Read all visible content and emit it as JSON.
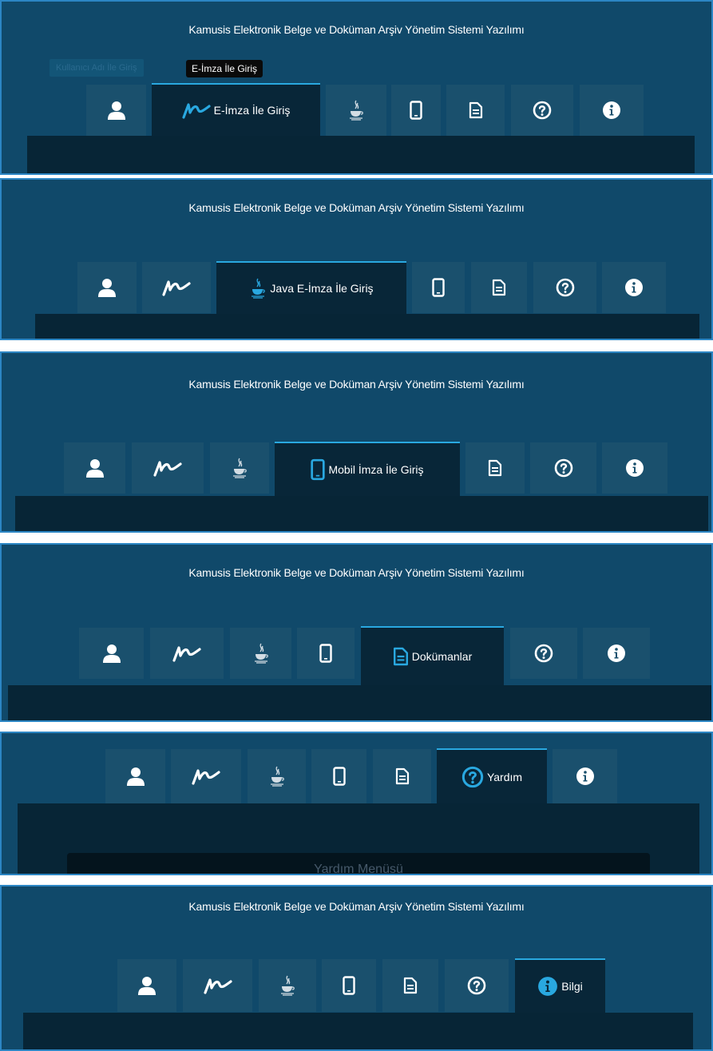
{
  "app_title": "Kamusis Elektronik Belge ve Doküman Arşiv Yönetim Sistemi Yazılımı",
  "tabs": {
    "user": {
      "icon": "user-icon",
      "label": "Kullanıcı Adı İle Giriş"
    },
    "eimza": {
      "icon": "signature-icon",
      "label": "E-İmza İle Giriş"
    },
    "java": {
      "icon": "java-icon",
      "label": "Java E-İmza İle Giriş"
    },
    "mobil": {
      "icon": "mobile-phone-icon",
      "label": "Mobil İmza İle Giriş"
    },
    "dokuman": {
      "icon": "document-icon",
      "label": "Dokümanlar"
    },
    "yardim": {
      "icon": "question-circle-icon",
      "label": "Yardım"
    },
    "bilgi": {
      "icon": "info-circle-icon",
      "label": "Bilgi"
    }
  },
  "tooltip": "E-İmza İle Giriş",
  "faded_label": "Kullanıcı Adı İle Giriş",
  "help_menu_title": "Yardım Menüsü",
  "colors": {
    "panel_bg": "#10496a",
    "tab_bg": "#1a506d",
    "active_tab_bg": "#082638",
    "accent_blue": "#29a8e0",
    "content_bar_bg": "#072536"
  }
}
